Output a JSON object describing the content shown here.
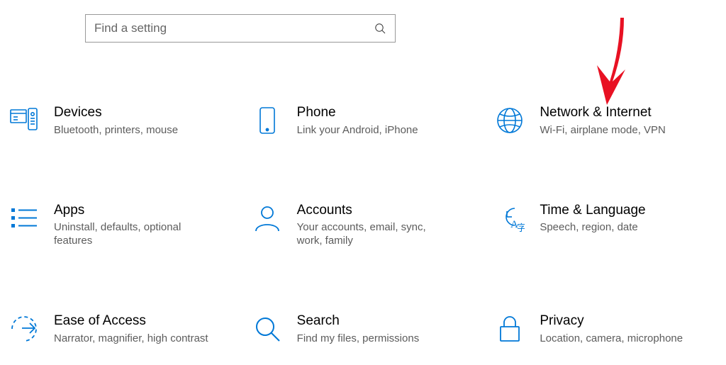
{
  "search": {
    "placeholder": "Find a setting"
  },
  "tiles": [
    {
      "title": "Devices",
      "desc": "Bluetooth, printers, mouse"
    },
    {
      "title": "Phone",
      "desc": "Link your Android, iPhone"
    },
    {
      "title": "Network & Internet",
      "desc": "Wi-Fi, airplane mode, VPN"
    },
    {
      "title": "Apps",
      "desc": "Uninstall, defaults, optional features"
    },
    {
      "title": "Accounts",
      "desc": "Your accounts, email, sync, work, family"
    },
    {
      "title": "Time & Language",
      "desc": "Speech, region, date"
    },
    {
      "title": "Ease of Access",
      "desc": "Narrator, magnifier, high contrast"
    },
    {
      "title": "Search",
      "desc": "Find my files, permissions"
    },
    {
      "title": "Privacy",
      "desc": "Location, camera, microphone"
    }
  ],
  "colors": {
    "accent": "#0078D7",
    "muted": "#5c5c5c"
  }
}
